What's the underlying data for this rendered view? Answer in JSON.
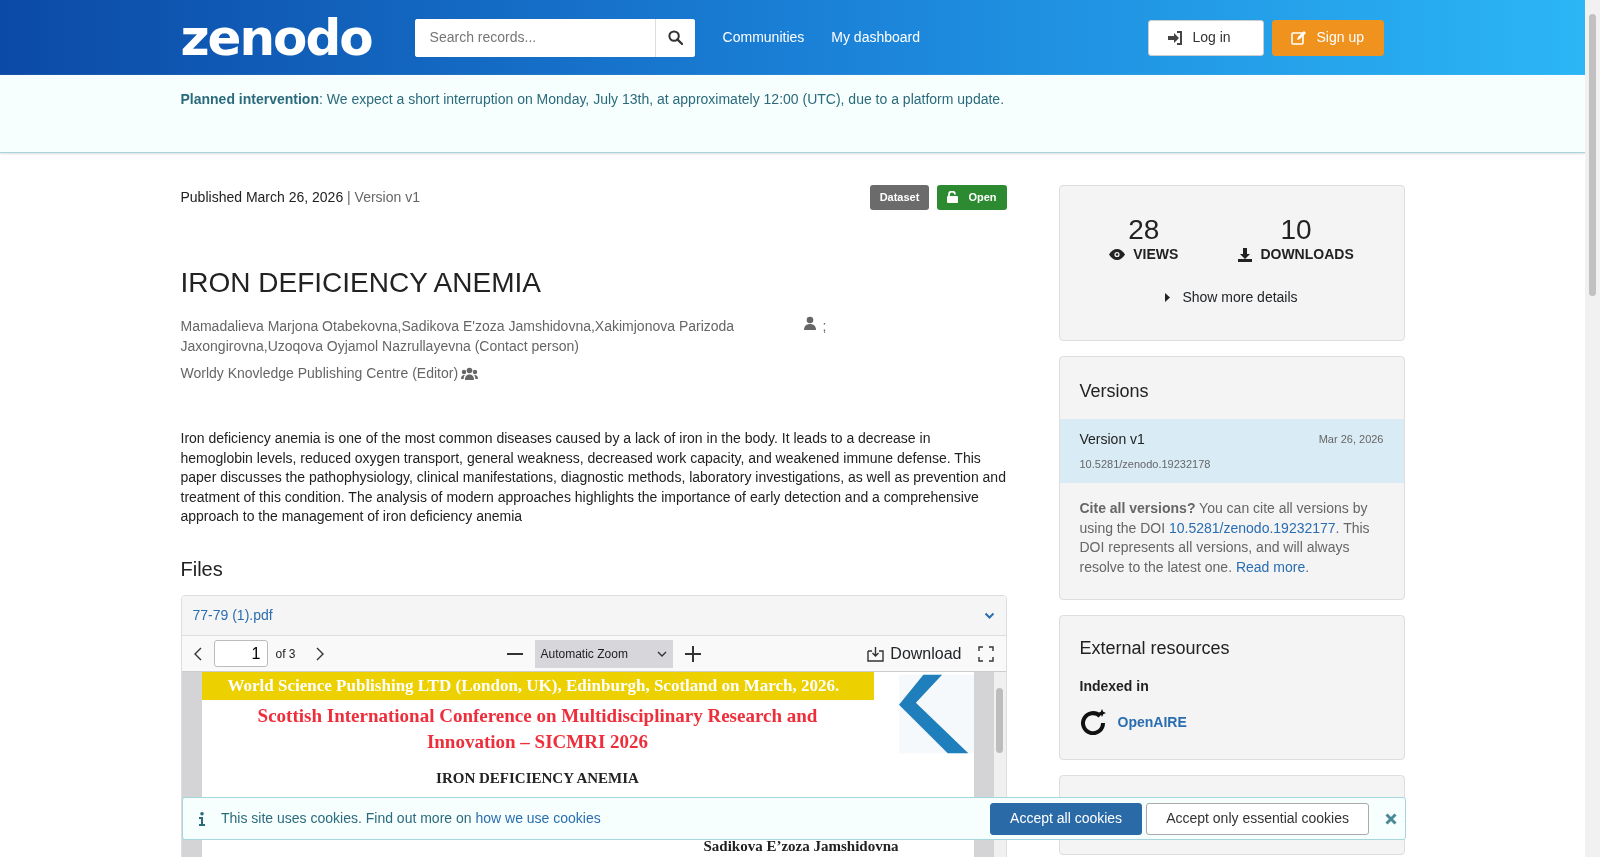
{
  "header": {
    "logo": "zenodo",
    "search": {
      "placeholder": "Search records..."
    },
    "nav": [
      {
        "label": "Communities"
      },
      {
        "label": "My dashboard"
      }
    ],
    "buttons": [
      {
        "label": "Log in",
        "kind": "login"
      },
      {
        "label": "Sign up",
        "kind": "signup"
      }
    ]
  },
  "notice": {
    "text": "**Planned intervention**: We expect a short interruption on Monday, July 13th, at approximately 12:00 (UTC), due to a platform update."
  },
  "record": {
    "published": "Published March 26, 2026",
    "version": "| Version v1",
    "badges": [
      {
        "label": "Dataset",
        "kind": "type"
      },
      {
        "label": "Open",
        "kind": "access"
      }
    ],
    "title": "IRON DEFICIENCY ANEMIA",
    "creators": "Mamadalieva Marjona Otabekovna,Sadikova E'zoza Jamshidovna,Xakimjonova Parizoda Jaxongirovna,Uzoqova Oyjamol Nazrullayevna (Contact person)",
    "creators_separator": ";",
    "contributor": "Worldy Knovledge Publishing Centre (Editor)",
    "description": "Iron deficiency anemia is one of the most common diseases caused by a lack of iron in the body. It leads to a decrease in hemoglobin levels, reduced oxygen transport, general weakness, decreased work capacity, and weakened immune defense. This paper discusses the pathophysiology, clinical manifestations, diagnostic methods, laboratory investigations, as well as prevention and treatment of this condition. The analysis of modern approaches highlights the importance of early detection and a comprehensive approach to the management of iron deficiency anemia"
  },
  "files": {
    "heading": "Files",
    "filename": "77-79 (1).pdf",
    "expanded": true,
    "viewer": {
      "page": "1",
      "page_count": "of 3",
      "zoom": "Automatic Zoom",
      "download": "Download",
      "document": {
        "banner": "World Science Publishing LTD (London, UK), Edinburgh, Scotland on March, 2026.",
        "conference": [
          "Scottish International Conference on Multidisciplinary Research and",
          "Innovation – SICMRI 2026"
        ],
        "title": "IRON DEFICIENCY ANEMIA",
        "author": "Sadikova E’zoza Jamshidovna"
      }
    }
  },
  "stats": {
    "items": [
      {
        "value": "28",
        "label": "VIEWS",
        "kind": "views"
      },
      {
        "value": "10",
        "label": "DOWNLOADS",
        "kind": "downloads"
      }
    ],
    "show_more": "Show more details"
  },
  "versions": {
    "heading": "Versions",
    "items": [
      {
        "label": "Version v1",
        "date": "Mar 26, 2026",
        "doi": "10.5281/zenodo.19232178",
        "selected": true
      }
    ],
    "cite": {
      "lead": "**Cite all versions?** You can cite all versions by using the DOI ",
      "doi": "10.5281/zenodo.19232177",
      "middle": ". This DOI represents all versions, and will always resolve to the latest one. ",
      "read_more": "Read more",
      "end": "."
    }
  },
  "external": {
    "heading": "External resources",
    "subheading": "Indexed in",
    "items": [
      {
        "label": "OpenAIRE"
      }
    ]
  },
  "cookies": {
    "text": "This site uses cookies. Find out more on ",
    "link": "how we use cookies",
    "buttons": [
      {
        "label": "Accept all cookies",
        "kind": "primary"
      },
      {
        "label": "Accept only essential cookies",
        "kind": "secondary"
      }
    ]
  }
}
